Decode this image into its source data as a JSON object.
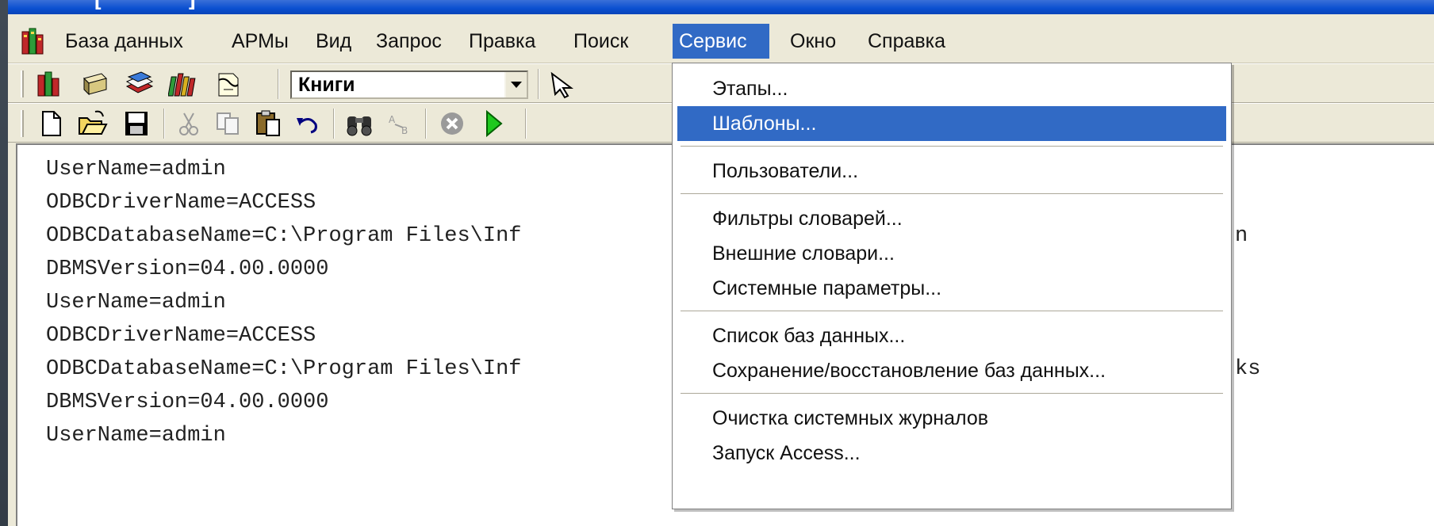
{
  "window": {
    "title": "          [           ]"
  },
  "menubar": {
    "items": [
      "База данных",
      "АРМы",
      "Вид",
      "Запрос",
      "Правка",
      "Поиск",
      "Сервис",
      "Окно",
      "Справка"
    ],
    "active": "Сервис"
  },
  "toolbar": {
    "combo_value": "Книги"
  },
  "editor": {
    "lines": [
      "UserName=admin",
      "ODBCDriverName=ACCESS",
      "ODBCDatabaseName=C:\\Program Files\\Inf",
      "DBMSVersion=04.00.0000",
      "UserName=admin",
      "ODBCDriverName=ACCESS",
      "ODBCDatabaseName=C:\\Program Files\\Inf",
      "DBMSVersion=04.00.0000",
      "UserName=admin"
    ],
    "tails": [
      "n",
      "ks"
    ]
  },
  "service_menu": {
    "items": [
      "Этапы...",
      "Шаблоны...",
      "Пользователи...",
      "Фильтры словарей...",
      "Внешние словари...",
      "Системные параметры...",
      "Список баз данных...",
      "Сохранение/восстановление баз данных...",
      "Очистка системных журналов",
      "Запуск Access..."
    ],
    "highlighted": "Шаблоны..."
  },
  "icons": [
    "app-books-icon",
    "books-icon",
    "catalog-icon",
    "magazines-icon",
    "stack-icon",
    "document-icon",
    "pointer-icon",
    "new-file-icon",
    "open-folder-icon",
    "save-icon",
    "cut-icon",
    "copy-icon",
    "paste-icon",
    "undo-icon",
    "find-icon",
    "replace-icon",
    "stop-icon",
    "run-icon"
  ],
  "colors": {
    "highlight": "#316ac5",
    "face": "#ece9d8",
    "run_green": "#1fc81f"
  }
}
